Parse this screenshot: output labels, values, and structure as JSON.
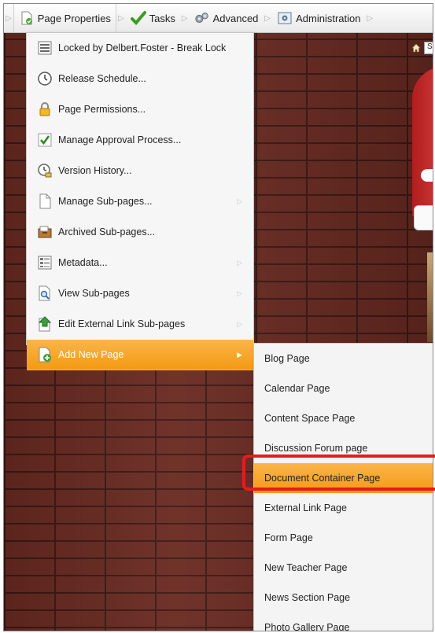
{
  "toolbar": {
    "items": [
      {
        "label": "Page Properties",
        "icon": "page-properties-icon"
      },
      {
        "label": "Tasks",
        "icon": "checkmark-icon"
      },
      {
        "label": "Advanced",
        "icon": "gears-icon"
      },
      {
        "label": "Administration",
        "icon": "administration-icon"
      }
    ]
  },
  "menu": {
    "items": [
      {
        "label": "Locked by Delbert.Foster - Break Lock",
        "icon": "lock-document-icon",
        "has_submenu": false
      },
      {
        "label": "Release Schedule...",
        "icon": "clock-icon",
        "has_submenu": false
      },
      {
        "label": "Page Permissions...",
        "icon": "padlock-icon",
        "has_submenu": false
      },
      {
        "label": "Manage Approval Process...",
        "icon": "approval-check-icon",
        "has_submenu": false
      },
      {
        "label": "Version History...",
        "icon": "version-history-icon",
        "has_submenu": false
      },
      {
        "label": "Manage Sub-pages...",
        "icon": "document-icon",
        "has_submenu": true
      },
      {
        "label": "Archived Sub-pages...",
        "icon": "archive-icon",
        "has_submenu": false
      },
      {
        "label": "Metadata...",
        "icon": "metadata-icon",
        "has_submenu": true
      },
      {
        "label": "View Sub-pages",
        "icon": "magnifier-document-icon",
        "has_submenu": true
      },
      {
        "label": "Edit External Link Sub-pages",
        "icon": "external-link-icon",
        "has_submenu": true
      },
      {
        "label": "Add New Page",
        "icon": "add-page-icon",
        "has_submenu": true
      }
    ]
  },
  "submenu": {
    "items": [
      "Blog Page",
      "Calendar Page",
      "Content Space Page",
      "Discussion Forum page",
      "Document Container Page",
      "External Link Page",
      "Form Page",
      "New Teacher Page",
      "News Section Page",
      "Photo Gallery Page"
    ]
  },
  "page": {
    "search_placeholder": "S"
  },
  "colors": {
    "accent": "#f6a21f",
    "highlight": "#e41c1c",
    "brick": "#6a2b22"
  }
}
